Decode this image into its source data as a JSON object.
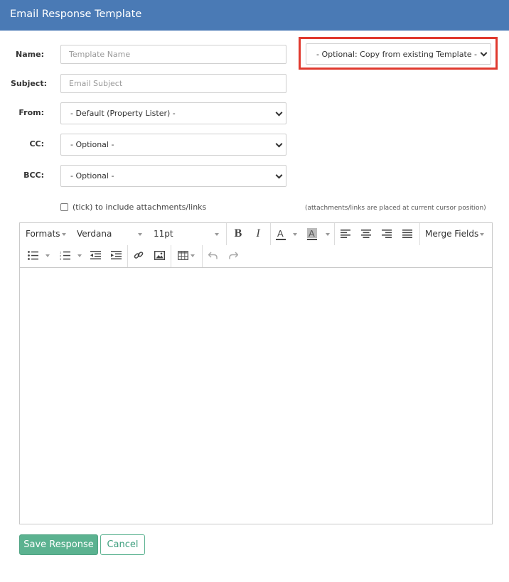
{
  "header": {
    "title": "Email Response Template"
  },
  "form": {
    "name_label": "Name:",
    "name_placeholder": "Template Name",
    "subject_label": "Subject:",
    "subject_placeholder": "Email Subject",
    "from_label": "From:",
    "from_value": "- Default (Property Lister) -",
    "cc_label": "CC:",
    "cc_value": "- Optional -",
    "bcc_label": "BCC:",
    "bcc_value": "- Optional -",
    "copy_template_value": "- Optional: Copy from existing Template -",
    "attachments_label": "(tick) to include attachments/links",
    "attachments_note": "(attachments/links are placed at current cursor position)"
  },
  "editor": {
    "formats_label": "Formats",
    "font_family": "Verdana",
    "font_size": "11pt",
    "merge_fields_label": "Merge Fields",
    "icons": [
      "bold-icon",
      "italic-icon",
      "text-color-icon",
      "background-color-icon",
      "align-left-icon",
      "align-center-icon",
      "align-right-icon",
      "align-justify-icon",
      "bullet-list-icon",
      "numbered-list-icon",
      "outdent-icon",
      "indent-icon",
      "link-icon",
      "image-icon",
      "table-icon",
      "undo-icon",
      "redo-icon"
    ],
    "content": ""
  },
  "actions": {
    "save_label": "Save Response",
    "cancel_label": "Cancel"
  },
  "colors": {
    "header_bg": "#4a7ab5",
    "highlight": "#e03a2f",
    "primary": "#5bb290"
  }
}
